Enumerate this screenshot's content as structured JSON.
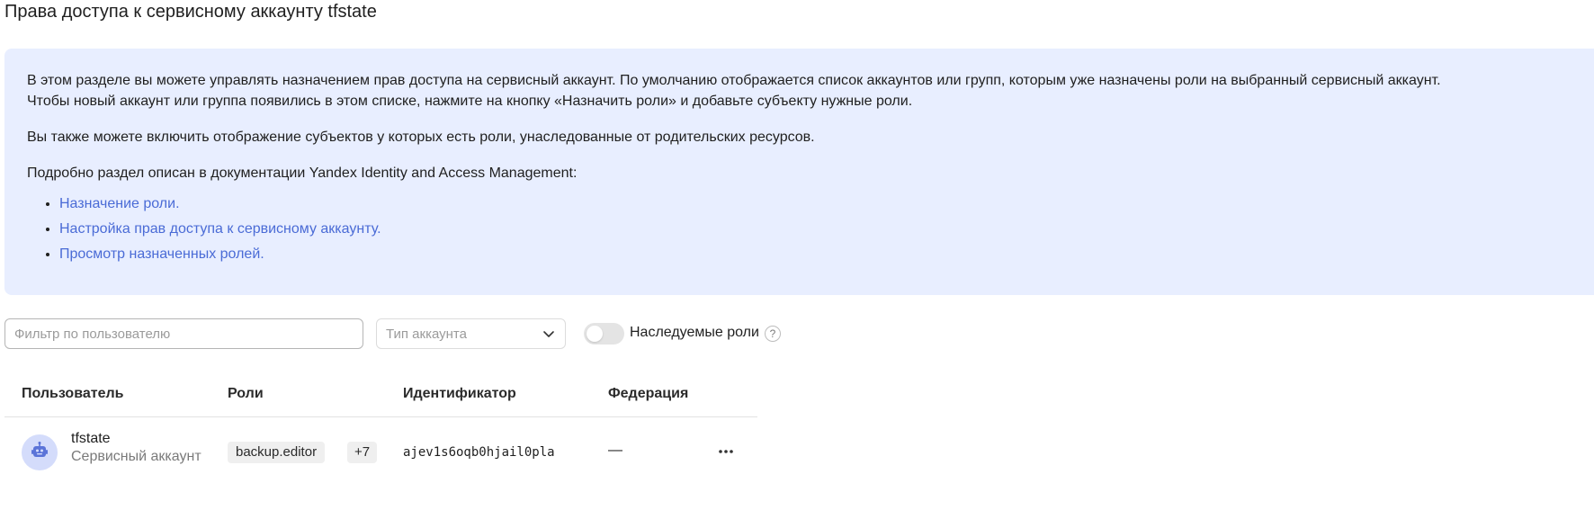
{
  "page": {
    "title": "Права доступа к сервисному аккаунту tfstate"
  },
  "info": {
    "paragraph1_line1": "В этом разделе вы можете управлять назначением прав доступа на сервисный аккаунт. По умолчанию отображается список аккаунтов или групп, которым уже назначены роли на выбранный сервисный аккаунт.",
    "paragraph1_line2": "Чтобы новый аккаунт или группа появились в этом списке, нажмите на кнопку «Назначить роли» и добавьте субъекту нужные роли.",
    "paragraph2": "Вы также можете включить отображение субъектов у которых есть роли, унаследованные от родительских ресурсов.",
    "paragraph3": "Подробно раздел описан в документации Yandex Identity and Access Management:",
    "links": [
      "Назначение роли.",
      "Настройка прав доступа к сервисному аккаунту.",
      "Просмотр назначенных ролей."
    ]
  },
  "filters": {
    "user_filter_placeholder": "Фильтр по пользователю",
    "account_type_placeholder": "Тип аккаунта",
    "inherited_roles_label": "Наследуемые роли",
    "inherited_roles_enabled": false,
    "help_glyph": "?"
  },
  "table": {
    "columns": [
      "Пользователь",
      "Роли",
      "Идентификатор",
      "Федерация"
    ],
    "rows": [
      {
        "avatar_icon": "robot-icon",
        "name": "tfstate",
        "type": "Сервисный аккаунт",
        "role": "backup.editor",
        "more_roles": "+7",
        "identifier": "ajev1s6oqb0hjail0pla",
        "federation": "—"
      }
    ]
  },
  "colors": {
    "info_background": "#e8eeff",
    "link": "#4a6bd6",
    "avatar_background": "#d4dcfb",
    "avatar_icon": "#5b74d8"
  }
}
